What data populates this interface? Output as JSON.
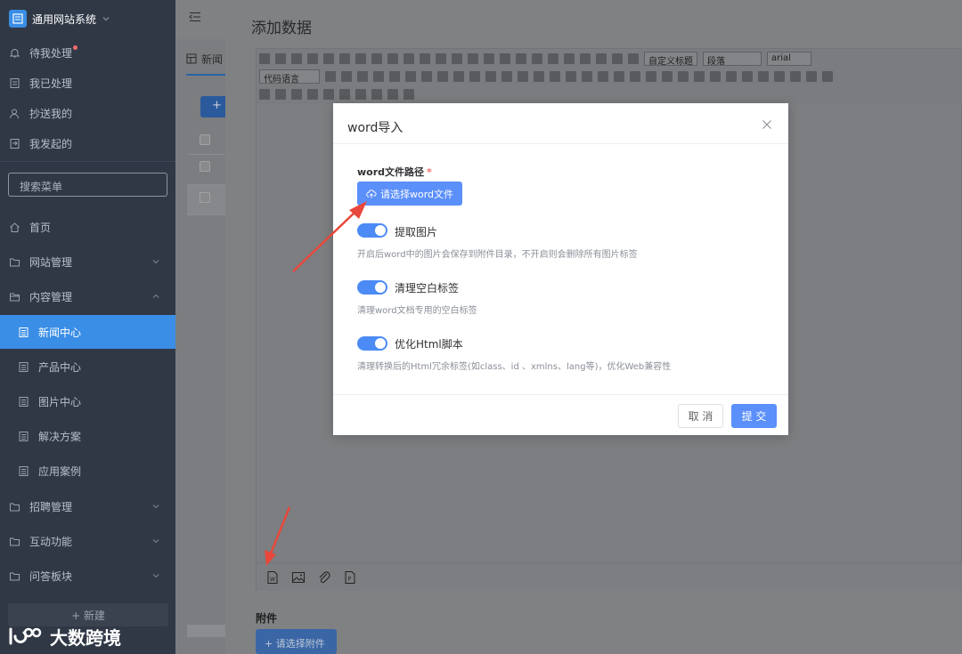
{
  "sidebar": {
    "app_title": "通用网站系统",
    "pending_items": [
      {
        "label": "待我处理",
        "icon": "bell-icon"
      },
      {
        "label": "我已处理",
        "icon": "checklist-icon"
      },
      {
        "label": "抄送我的",
        "icon": "user-icon"
      },
      {
        "label": "我发起的",
        "icon": "send-icon"
      }
    ],
    "search_placeholder": "搜索菜单",
    "menu": [
      {
        "label": "首页",
        "icon": "home-icon"
      },
      {
        "label": "网站管理",
        "icon": "folder-icon"
      },
      {
        "label": "内容管理",
        "icon": "folder-open-icon"
      },
      {
        "label": "新闻中心",
        "icon": "document-icon"
      },
      {
        "label": "产品中心",
        "icon": "document-icon"
      },
      {
        "label": "图片中心",
        "icon": "document-icon"
      },
      {
        "label": "解决方案",
        "icon": "document-icon"
      },
      {
        "label": "应用案例",
        "icon": "document-icon"
      },
      {
        "label": "招聘管理",
        "icon": "folder-icon"
      },
      {
        "label": "互动功能",
        "icon": "folder-icon"
      },
      {
        "label": "问答板块",
        "icon": "folder-icon"
      }
    ],
    "new_button": "+ 新建"
  },
  "background": {
    "tab_label": "新闻",
    "add_button": "+"
  },
  "drawer": {
    "title": "添加数据",
    "toolbar": {
      "code_language": "代码语言",
      "heading_select": "自定义标题",
      "paragraph_select": "段落",
      "font_select": "arial"
    },
    "attachments_label": "附件",
    "attachments_button": "+ 请选择附件"
  },
  "modal": {
    "title": "word导入",
    "path_label": "word文件路径",
    "required_mark": "*",
    "upload_button": "请选择word文件",
    "options": [
      {
        "label": "提取图片",
        "description": "开启后word中的图片会保存到附件目录，不开启则会删除所有图片标签",
        "enabled": true
      },
      {
        "label": "清理空白标签",
        "description": "清理word文档专用的空白标签",
        "enabled": true
      },
      {
        "label": "优化Html脚本",
        "description": "清理转换后的Html冗余标签(如class、id 、xmlns、lang等)，优化Web兼容性",
        "enabled": true
      }
    ],
    "cancel_button": "取 消",
    "submit_button": "提 交"
  },
  "watermark": {
    "text": "大数跨境"
  },
  "colors": {
    "sidebar_bg": "#303846",
    "primary": "#5b8ff9",
    "switch_on": "#4c8bf5",
    "arrow": "#e8483b"
  }
}
